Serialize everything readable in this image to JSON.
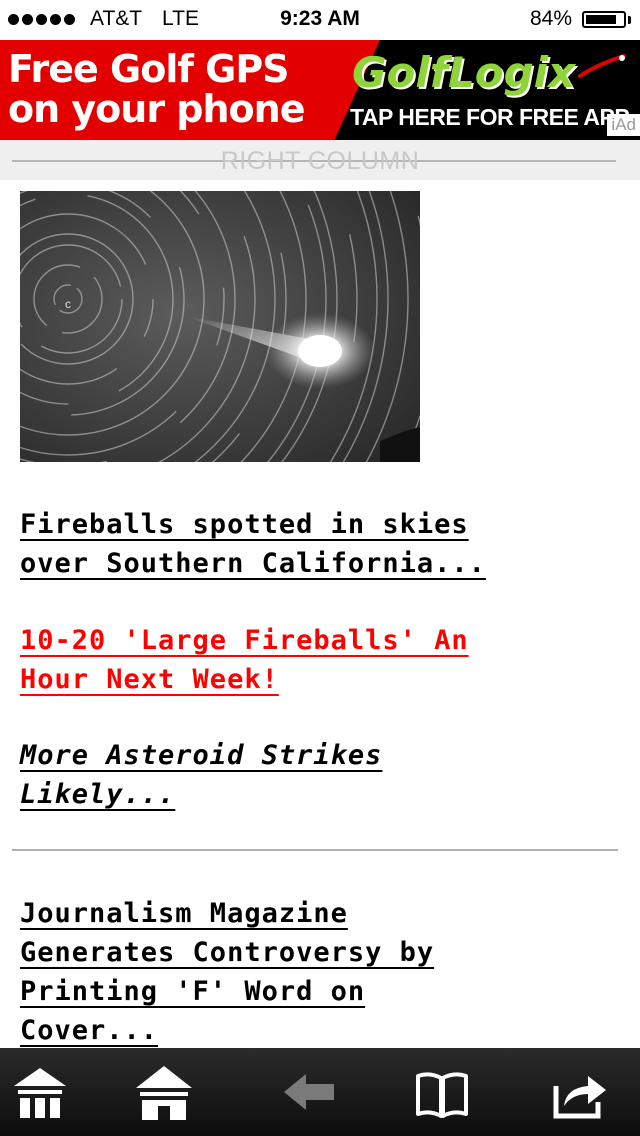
{
  "status_bar": {
    "carrier": "AT&T",
    "network": "LTE",
    "time": "9:23 AM",
    "battery_percent": "84%",
    "battery_level": 0.84
  },
  "ad": {
    "headline_line1": "Free Golf GPS",
    "headline_line2": "on your phone",
    "brand": "GolfLogix",
    "cta": "TAP HERE FOR FREE APP",
    "badge": "iAd",
    "brand_color": "#8fd43a",
    "accent_color": "#e30000"
  },
  "column_divider": {
    "label": "RIGHT COLUMN"
  },
  "photo": {
    "subject": "star-trails-fireball-photo"
  },
  "headlines": [
    {
      "lines": [
        "Fireballs spotted in skies ",
        "over Southern California..."
      ],
      "color": "#000000",
      "style": "normal"
    },
    {
      "lines": [
        "10-20 'Large Fireballs' An ",
        "Hour Next Week!"
      ],
      "color": "#ff0000",
      "style": "normal"
    },
    {
      "lines": [
        "More Asteroid Strikes ",
        "Likely..."
      ],
      "color": "#000000",
      "style": "italic"
    },
    {
      "lines": [
        "Journalism Magazine ",
        "Generates Controversy by ",
        "Printing 'F' Word on ",
        "Cover..."
      ],
      "color": "#000000",
      "style": "normal"
    }
  ],
  "toolbar": {
    "items": [
      "menu-home-icon",
      "home-icon",
      "back-arrow-icon",
      "bookmarks-icon",
      "share-icon"
    ]
  }
}
